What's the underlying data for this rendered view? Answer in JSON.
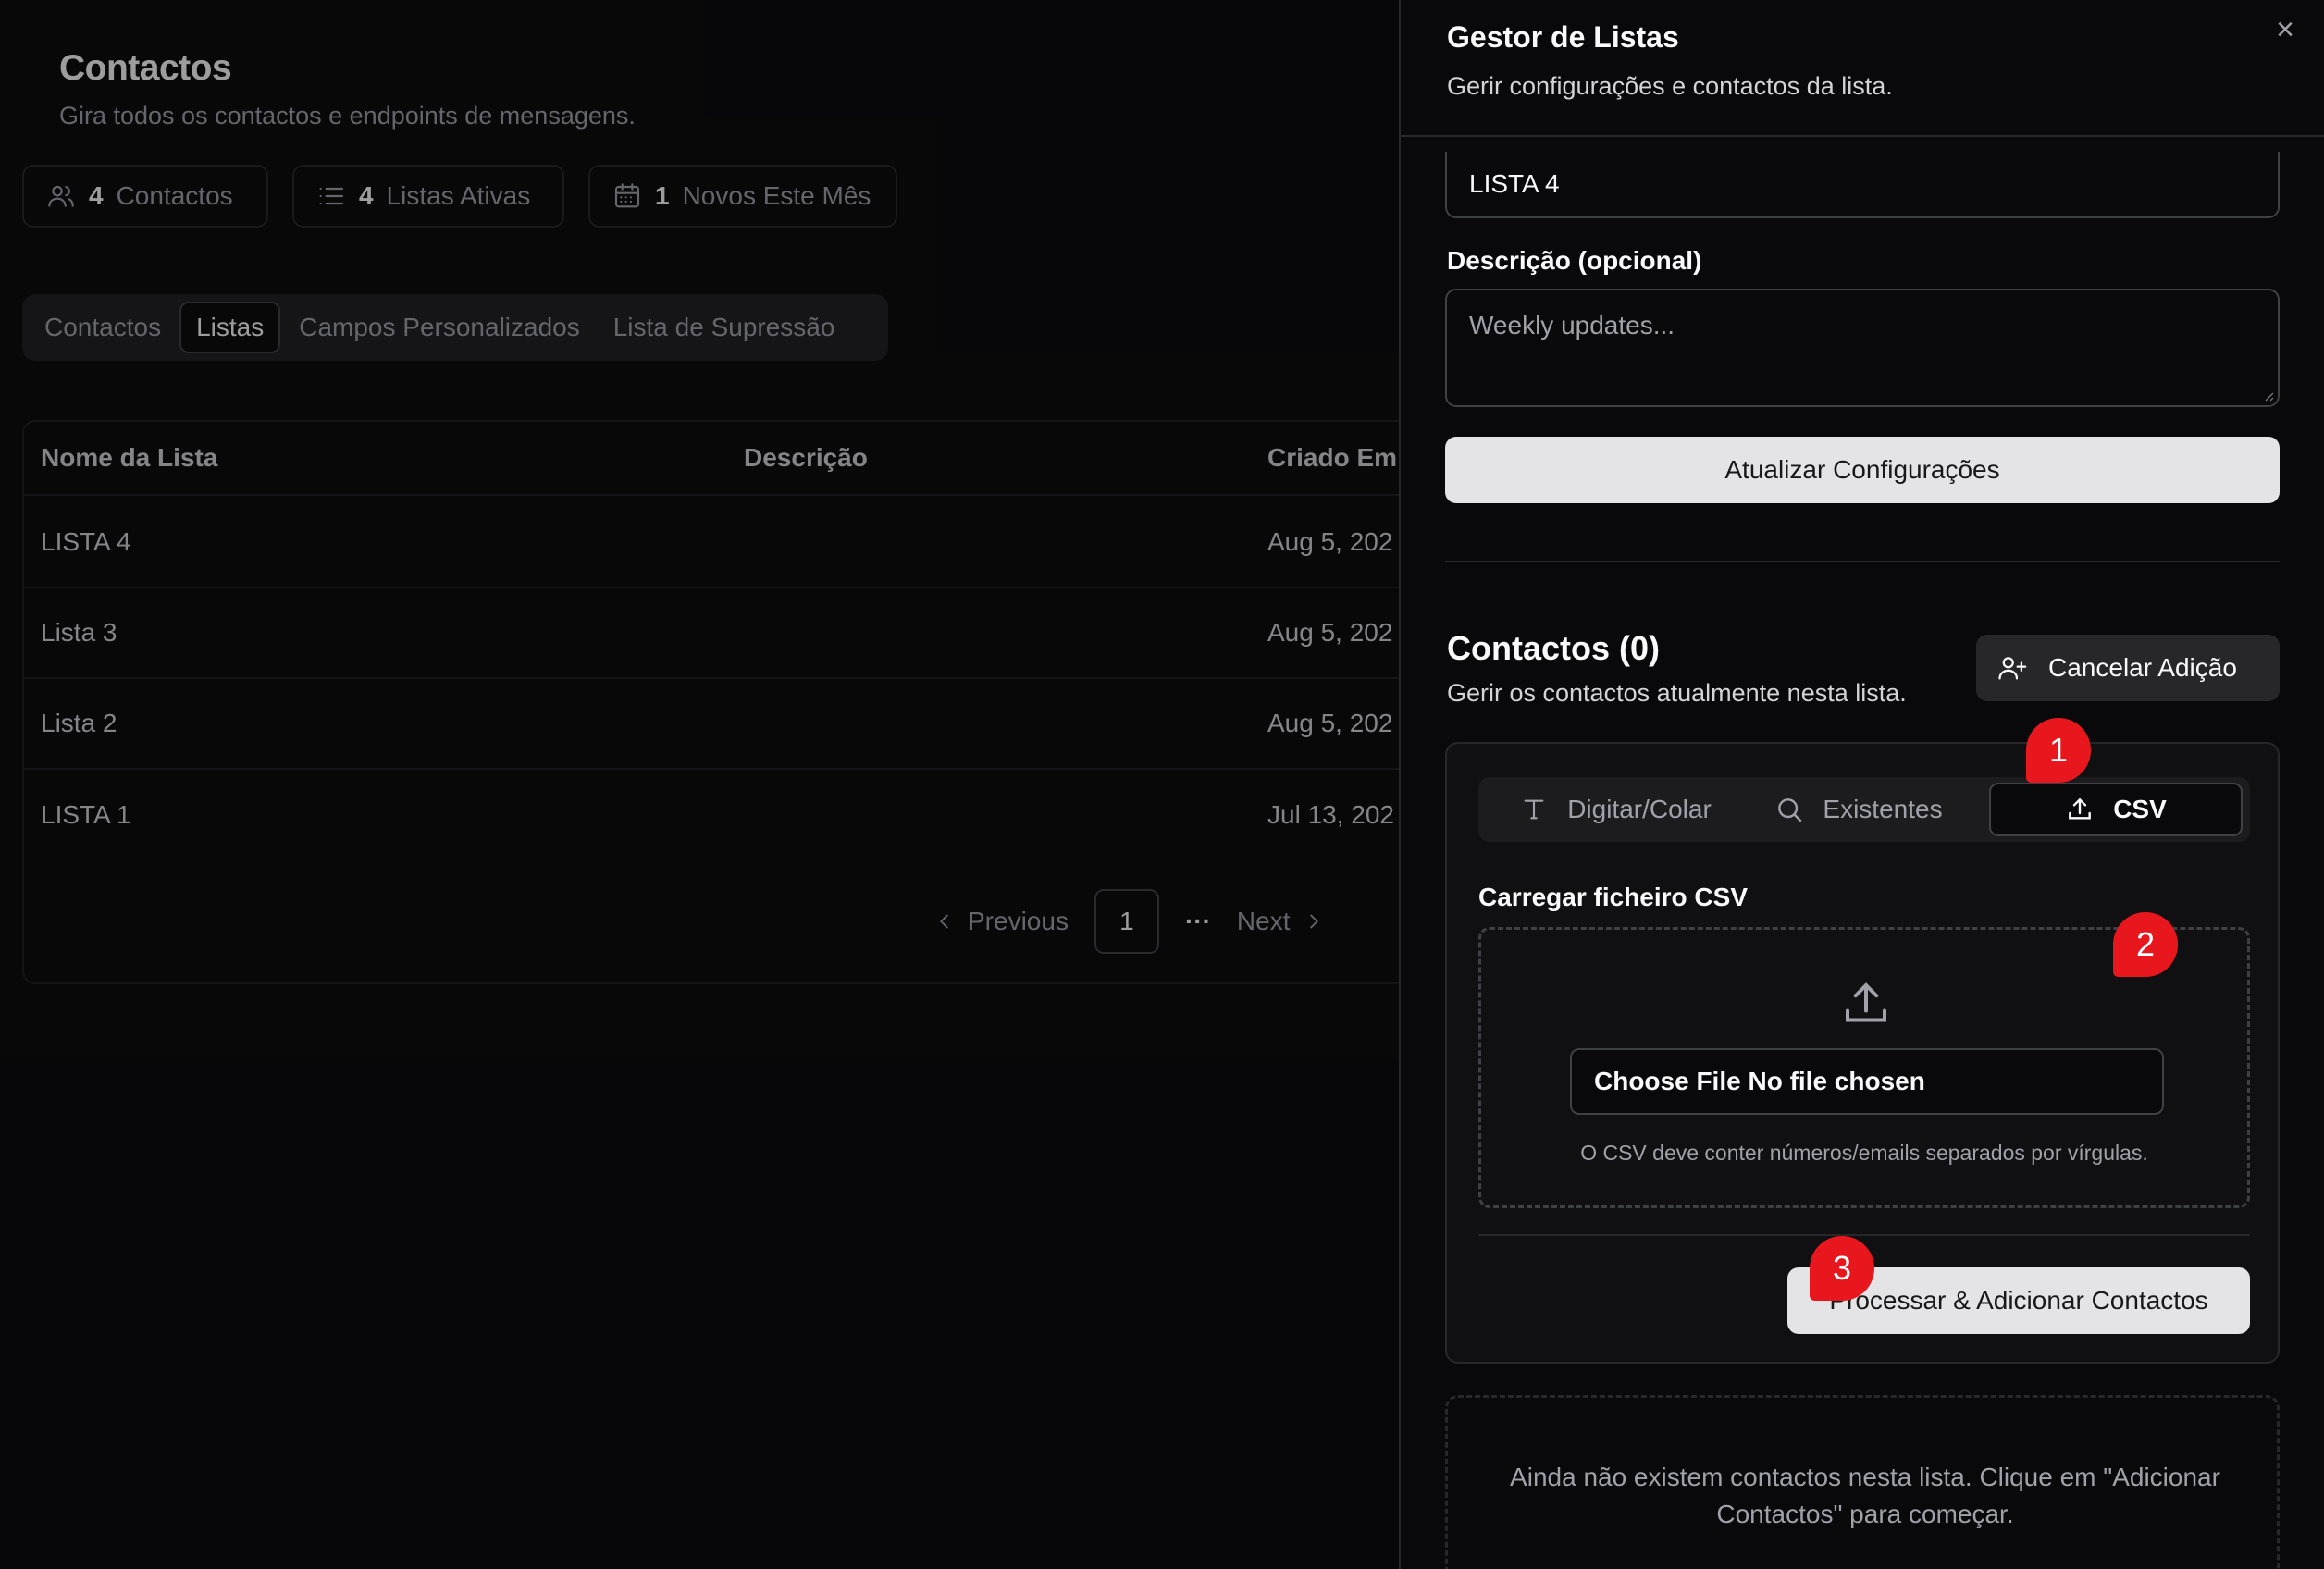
{
  "background": {
    "title": "Contactos",
    "subtitle": "Gira todos os contactos e endpoints de mensagens.",
    "stats": [
      {
        "num": "4",
        "label": "Contactos",
        "icon": "users-icon"
      },
      {
        "num": "4",
        "label": "Listas Ativas",
        "icon": "list-icon"
      },
      {
        "num": "1",
        "label": "Novos Este Mês",
        "icon": "calendar-icon"
      }
    ],
    "tabs": [
      "Contactos",
      "Listas",
      "Campos Personalizados",
      "Lista de Supressão"
    ],
    "active_tab": "Listas",
    "table": {
      "headers": [
        "Nome da Lista",
        "Descrição",
        "Criado Em"
      ],
      "rows": [
        {
          "name": "LISTA 4",
          "description": "",
          "created": "Aug 5, 202"
        },
        {
          "name": "Lista 3",
          "description": "",
          "created": "Aug 5, 202"
        },
        {
          "name": "Lista 2",
          "description": "",
          "created": "Aug 5, 202"
        },
        {
          "name": "LISTA 1",
          "description": "",
          "created": "Jul 13, 202"
        }
      ]
    },
    "pagination": {
      "previous": "Previous",
      "current": "1",
      "ellipsis": "···",
      "next": "Next"
    }
  },
  "panel": {
    "title": "Gestor de Listas",
    "subtitle": "Gerir configurações e contactos da lista.",
    "close": "×",
    "name_value": "LISTA 4",
    "description_label": "Descrição (opcional)",
    "description_placeholder": "Weekly updates...",
    "update_button": "Atualizar Configurações",
    "contacts_title": "Contactos (0)",
    "contacts_subtitle": "Gerir os contactos atualmente nesta lista.",
    "cancel_button": "Cancelar Adição",
    "modes": [
      {
        "label": "Digitar/Colar",
        "icon": "text-icon"
      },
      {
        "label": "Existentes",
        "icon": "search-icon"
      },
      {
        "label": "CSV",
        "icon": "upload-icon"
      }
    ],
    "active_mode": "CSV",
    "csv_label": "Carregar ficheiro CSV",
    "file_input": "Choose File No file chosen",
    "csv_help": "O CSV deve conter números/emails separados por vírgulas.",
    "process_button": "Processar & Adicionar Contactos",
    "empty_text": "Ainda não existem contactos nesta lista. Clique em \"Adicionar Contactos\" para começar."
  },
  "markers": [
    "1",
    "2",
    "3"
  ],
  "colors": {
    "marker": "#e8171d",
    "panel_bg": "#09090b",
    "light_button": "#e4e4e7"
  }
}
